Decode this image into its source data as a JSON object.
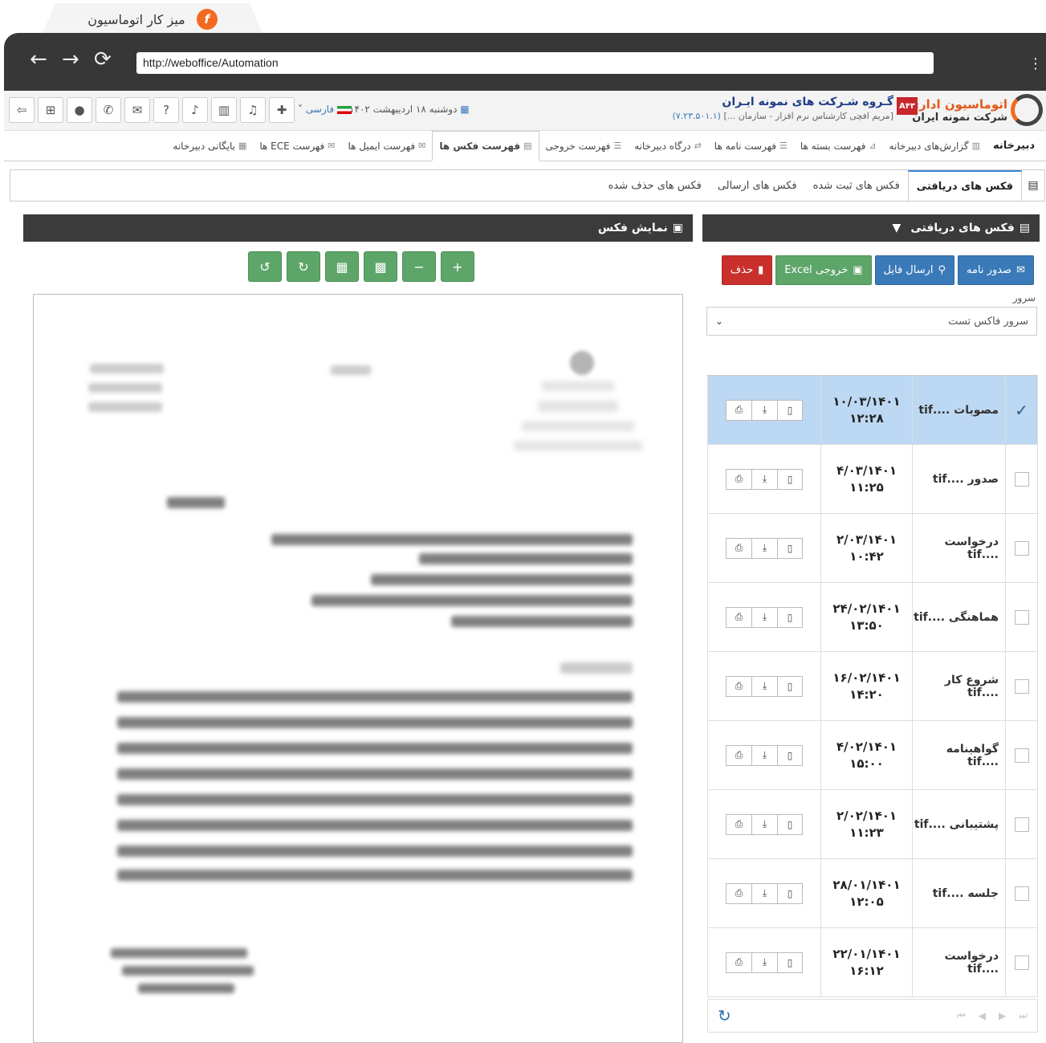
{
  "browser": {
    "tab_title": "میز کار اتوماسیون",
    "tab_logo": "f",
    "url": "http://weboffice/Automation",
    "back_icon": "←",
    "forward_icon": "→",
    "reload_icon": "⟳",
    "menu_icon": "⋮"
  },
  "header": {
    "brand_title": "اتوماسیون اداری",
    "brand_sub": "شرکت نمونه ایران",
    "company_badge": "A۴۳",
    "company_title": "گـروه شـرکت های نمونه ایـران",
    "company_sub": "[مریم افچی کارشناس نرم افزار - سازمان ...]",
    "version": "(۷.۲۳.۵۰۱.۱)",
    "date": "دوشنبه ۱۸ اردیبهشت ۱۴۰۲",
    "date_icon": "▦",
    "lang": "فارسی",
    "lang_arrow": "˅",
    "toolbar_icons": [
      {
        "name": "exit-icon",
        "glyph": "⇦"
      },
      {
        "name": "org-chart-icon",
        "glyph": "⊞"
      },
      {
        "name": "user-icon",
        "glyph": "●"
      },
      {
        "name": "chat-icon",
        "glyph": "✆"
      },
      {
        "name": "message-icon",
        "glyph": "✉"
      },
      {
        "name": "help-icon",
        "glyph": "?"
      },
      {
        "name": "mic-icon",
        "glyph": "♪"
      },
      {
        "name": "report-icon",
        "glyph": "▥"
      },
      {
        "name": "bell-icon",
        "glyph": "♫"
      },
      {
        "name": "puzzle-icon",
        "glyph": "✚"
      }
    ]
  },
  "menu": [
    {
      "label": "دبیرخانه",
      "icon": "",
      "home": true
    },
    {
      "label": "گزارش‌های دبیرخانه",
      "icon": "▥"
    },
    {
      "label": "فهرست بسته ها",
      "icon": "⊿"
    },
    {
      "label": "فهرست نامه ها",
      "icon": "☰"
    },
    {
      "label": "درگاه دبیرخانه",
      "icon": "⇄"
    },
    {
      "label": "فهرست خروجی",
      "icon": "☰"
    },
    {
      "label": "فهرست فکس ها",
      "icon": "▤",
      "active": true
    },
    {
      "label": "فهرست ایمیل ها",
      "icon": "✉"
    },
    {
      "label": "فهرست ECE ها",
      "icon": "✉"
    },
    {
      "label": "بایگانی دبیرخانه",
      "icon": "▦"
    }
  ],
  "subtabs": [
    {
      "label": "فکس های دریافتی",
      "active": true
    },
    {
      "label": "فکس های ثبت شده"
    },
    {
      "label": "فکس های ارسالی"
    },
    {
      "label": "فکس های حذف شده"
    }
  ],
  "viewer": {
    "title": "نمایش فکس",
    "title_icon": "▣",
    "tools": [
      {
        "name": "rotate-left-icon",
        "glyph": "↺"
      },
      {
        "name": "rotate-right-icon",
        "glyph": "↻"
      },
      {
        "name": "grid-view-icon",
        "glyph": "▦"
      },
      {
        "name": "tile-view-icon",
        "glyph": "▩"
      },
      {
        "name": "zoom-out-icon",
        "glyph": "−"
      },
      {
        "name": "zoom-in-icon",
        "glyph": "+"
      }
    ]
  },
  "inbox": {
    "title": "فکس های دریافتی",
    "title_icon": "▤",
    "filter_icon": "▼",
    "actions": [
      {
        "name": "issue-letter-button",
        "label": "صدور نامه",
        "icon": "✉",
        "color": "blue"
      },
      {
        "name": "send-file-button",
        "label": "ارسال فایل",
        "icon": "⚲",
        "color": "blue"
      },
      {
        "name": "excel-export-button",
        "label": "خروجی Excel",
        "icon": "▣",
        "color": "green"
      },
      {
        "name": "delete-button",
        "label": "حذف",
        "icon": "▮",
        "color": "red"
      }
    ],
    "server_label": "سرور",
    "server_value": "سرور فاکس تست",
    "server_arrow": "⌄",
    "check_mark": "✓",
    "row_icons": {
      "print": "⎙",
      "download": "⤓",
      "delete": "▯"
    },
    "rows": [
      {
        "name": "مصوبات ....tif",
        "date": "۱۰/۰۳/۱۴۰۱",
        "time": "۱۲:۲۸",
        "selected": true
      },
      {
        "name": "صدور ....tif",
        "date": "۴/۰۳/۱۴۰۱",
        "time": "۱۱:۲۵",
        "selected": false
      },
      {
        "name": "درخواست ....tif",
        "date": "۲/۰۳/۱۴۰۱",
        "time": "۱۰:۴۲",
        "selected": false
      },
      {
        "name": "هماهنگی ....tif",
        "date": "۲۴/۰۲/۱۴۰۱",
        "time": "۱۳:۵۰",
        "selected": false
      },
      {
        "name": "شروع کار ....tif",
        "date": "۱۶/۰۲/۱۴۰۱",
        "time": "۱۴:۲۰",
        "selected": false
      },
      {
        "name": "گواهینامه ....tif",
        "date": "۴/۰۲/۱۴۰۱",
        "time": "۱۵:۰۰",
        "selected": false
      },
      {
        "name": "پشتیبانی ....tif",
        "date": "۲/۰۲/۱۴۰۱",
        "time": "۱۱:۲۳",
        "selected": false
      },
      {
        "name": "جلسه ....tif",
        "date": "۲۸/۰۱/۱۴۰۱",
        "time": "۱۲:۰۵",
        "selected": false
      },
      {
        "name": "درخواست ....tif",
        "date": "۲۲/۰۱/۱۴۰۱",
        "time": "۱۶:۱۲",
        "selected": false
      }
    ],
    "pager_icons": [
      "⏮",
      "◀",
      "▶",
      "⏭"
    ],
    "refresh_icon": "↻"
  },
  "colors": {
    "header_dark": "#3b3b3b",
    "action_blue": "#3a7ab8",
    "action_green": "#5ea56a",
    "action_red": "#c9302c",
    "selected_row": "#bcd8f2",
    "brand_orange": "#f26a21"
  }
}
